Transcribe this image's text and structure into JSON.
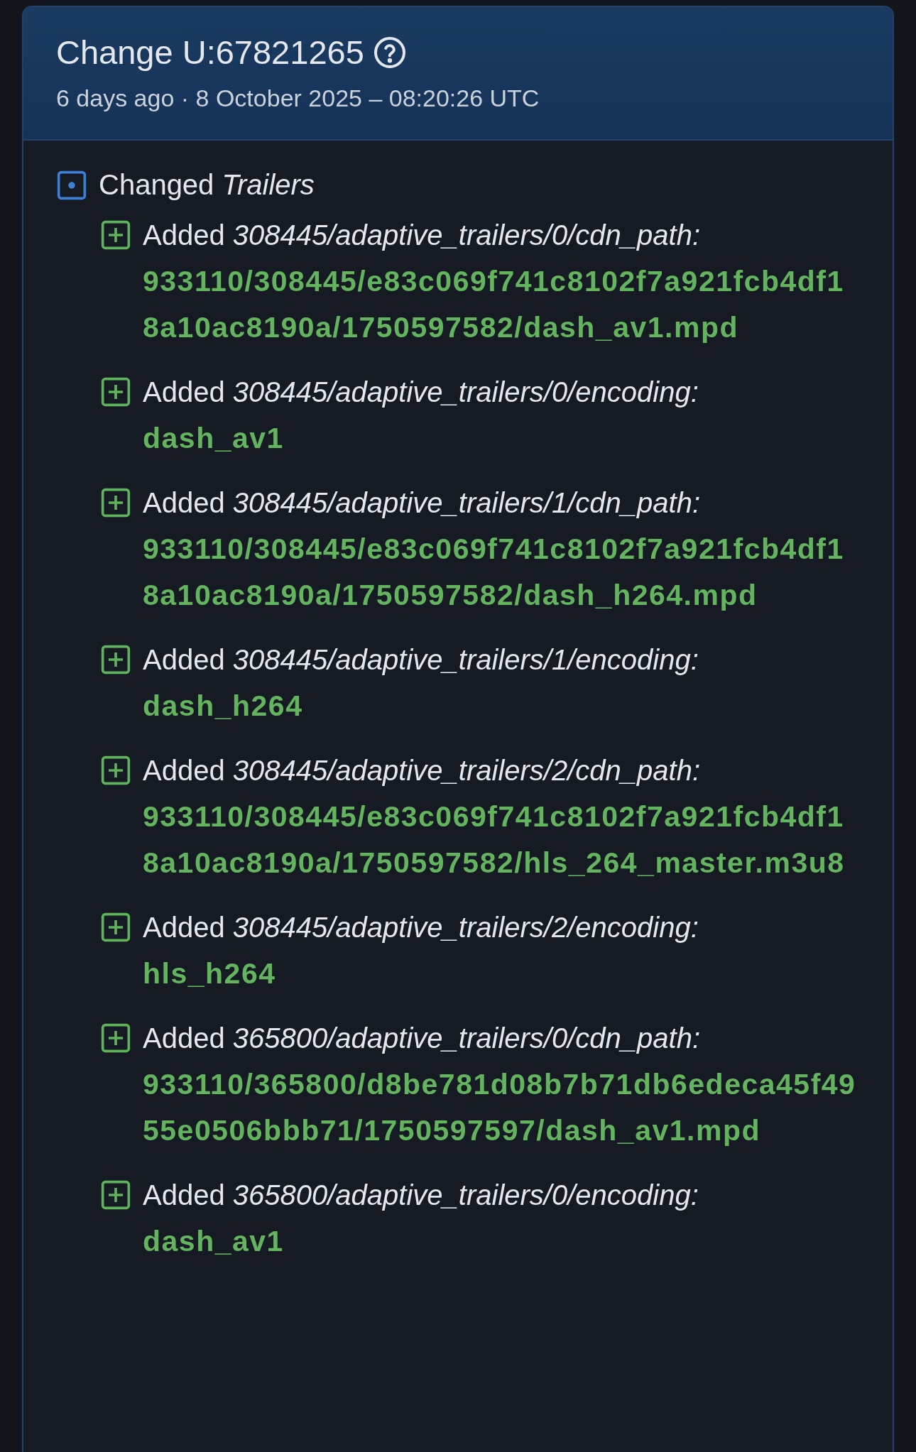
{
  "header": {
    "title": "Change U:67821265",
    "timestamp": "6 days ago · 8 October 2025 – 08:20:26 UTC"
  },
  "change": {
    "kind": "changed",
    "label": "Changed *Trailers*",
    "items": [
      {
        "kind": "added",
        "label": "Added *308445/adaptive_trailers/0/cdn_path:*",
        "value": "933110/308445/e83c069f741c8102f7a921fcb4df18a10ac8190a/1750597582/dash_av1.mpd"
      },
      {
        "kind": "added",
        "label": "Added *308445/adaptive_trailers/0/encoding:*",
        "value": "dash_av1"
      },
      {
        "kind": "added",
        "label": "Added *308445/adaptive_trailers/1/cdn_path:*",
        "value": "933110/308445/e83c069f741c8102f7a921fcb4df18a10ac8190a/1750597582/dash_h264.mpd"
      },
      {
        "kind": "added",
        "label": "Added *308445/adaptive_trailers/1/encoding:*",
        "value": "dash_h264"
      },
      {
        "kind": "added",
        "label": "Added *308445/adaptive_trailers/2/cdn_path:*",
        "value": "933110/308445/e83c069f741c8102f7a921fcb4df18a10ac8190a/1750597582/hls_264_master.m3u8"
      },
      {
        "kind": "added",
        "label": "Added *308445/adaptive_trailers/2/encoding:*",
        "value": "hls_h264"
      },
      {
        "kind": "added",
        "label": "Added *365800/adaptive_trailers/0/cdn_path:*",
        "value": "933110/365800/d8be781d08b7b71db6edeca45f4955e0506bbb71/1750597597/dash_av1.mpd"
      },
      {
        "kind": "added",
        "label": "Added *365800/adaptive_trailers/0/encoding:*",
        "value": "dash_av1"
      }
    ]
  }
}
